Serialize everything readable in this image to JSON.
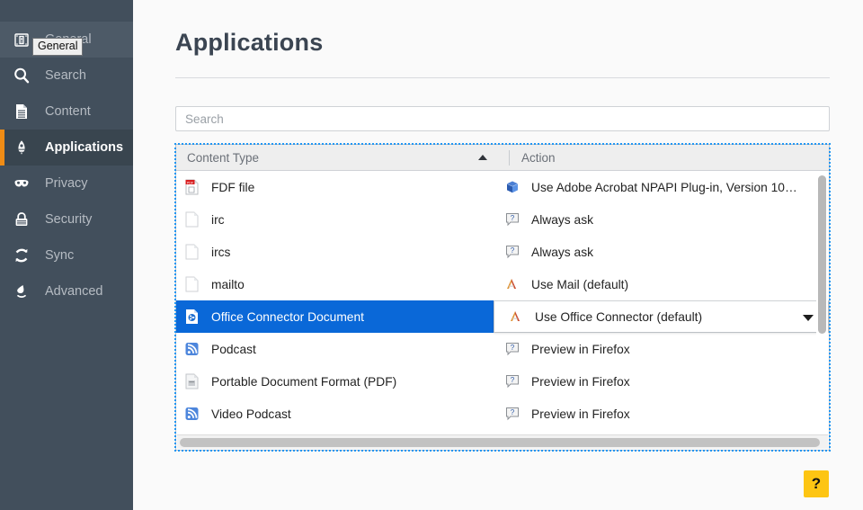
{
  "sidebar": {
    "items": [
      {
        "label": "General",
        "icon": "toolbox-icon",
        "state": "hovered"
      },
      {
        "label": "Search",
        "icon": "search-icon",
        "state": "normal"
      },
      {
        "label": "Content",
        "icon": "document-icon",
        "state": "normal"
      },
      {
        "label": "Applications",
        "icon": "rocket-icon",
        "state": "active"
      },
      {
        "label": "Privacy",
        "icon": "mask-icon",
        "state": "normal"
      },
      {
        "label": "Security",
        "icon": "padlock-icon",
        "state": "normal"
      },
      {
        "label": "Sync",
        "icon": "sync-icon",
        "state": "normal"
      },
      {
        "label": "Advanced",
        "icon": "flask-icon",
        "state": "normal"
      }
    ],
    "tooltip": "General",
    "active_accent_color": "#f08c15",
    "background_color": "#424f5c"
  },
  "main": {
    "title": "Applications",
    "search": {
      "value": "",
      "placeholder": "Search"
    },
    "table": {
      "columns": [
        {
          "key": "content_type",
          "label": "Content Type",
          "sort": "ascending"
        },
        {
          "key": "action",
          "label": "Action",
          "sort": "none"
        }
      ],
      "rows": [
        {
          "type": "FDF file",
          "type_icon": "pdf-file-icon",
          "action": "Use Adobe Acrobat NPAPI Plug-in, Version 10…",
          "action_icon": "adobe-box-icon",
          "selected": false
        },
        {
          "type": "irc",
          "type_icon": "blank-file-icon",
          "action": "Always ask",
          "action_icon": "question-ask-icon",
          "selected": false
        },
        {
          "type": "ircs",
          "type_icon": "blank-file-icon",
          "action": "Always ask",
          "action_icon": "question-ask-icon",
          "selected": false
        },
        {
          "type": "mailto",
          "type_icon": "blank-file-icon",
          "action": "Use Mail (default)",
          "action_icon": "mail-app-icon",
          "selected": false
        },
        {
          "type": "Office Connector Document",
          "type_icon": "office-connector-icon",
          "action": "Use Office Connector (default)",
          "action_icon": "mail-app-icon",
          "selected": true
        },
        {
          "type": "Podcast",
          "type_icon": "rss-feed-icon",
          "action": "Preview in Firefox",
          "action_icon": "question-ask-icon",
          "selected": false
        },
        {
          "type": "Portable Document Format (PDF)",
          "type_icon": "pdf-doc-icon",
          "action": "Preview in Firefox",
          "action_icon": "question-ask-icon",
          "selected": false
        },
        {
          "type": "Video Podcast",
          "type_icon": "rss-feed-icon",
          "action": "Preview in Firefox",
          "action_icon": "question-ask-icon",
          "selected": false
        }
      ]
    },
    "help_button": {
      "label": "?",
      "color": "#fdc513"
    }
  }
}
